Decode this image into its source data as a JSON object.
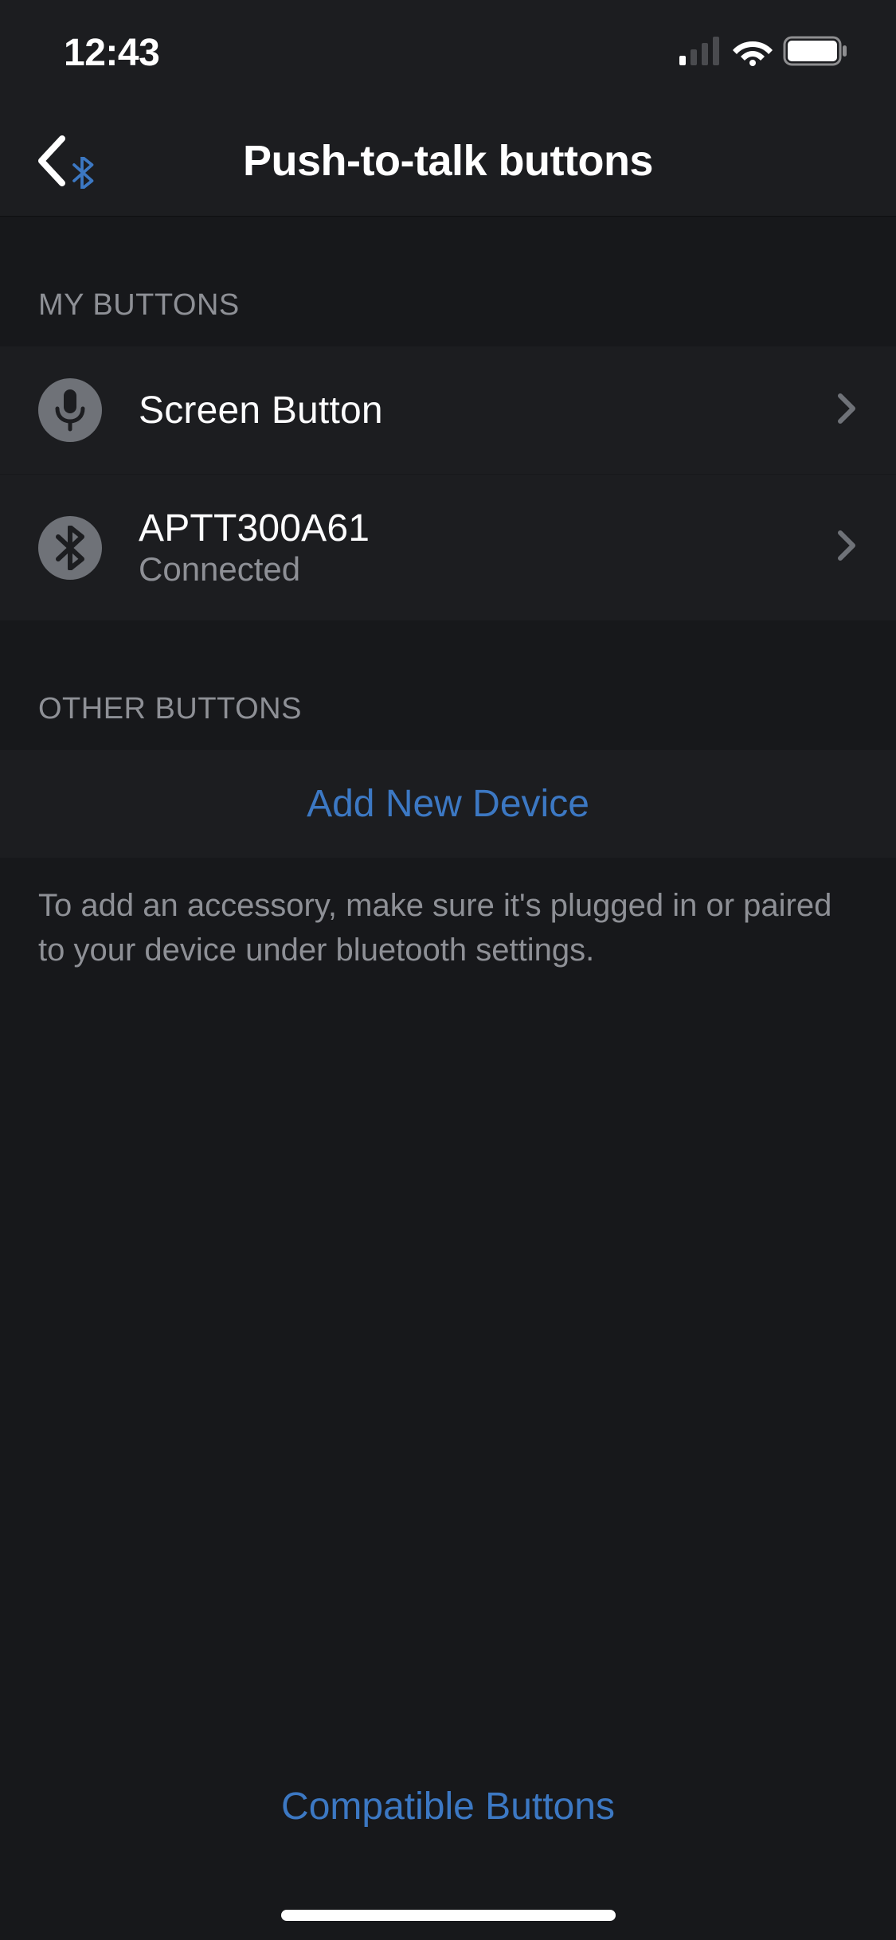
{
  "statusBar": {
    "time": "12:43"
  },
  "header": {
    "title": "Push-to-talk buttons"
  },
  "sections": {
    "myButtons": {
      "label": "MY BUTTONS",
      "items": [
        {
          "title": "Screen Button",
          "subtitle": "",
          "iconName": "mic-icon"
        },
        {
          "title": "APTT300A61",
          "subtitle": "Connected",
          "iconName": "bluetooth-icon"
        }
      ]
    },
    "otherButtons": {
      "label": "OTHER BUTTONS",
      "addDeviceLabel": "Add New Device",
      "helperText": "To add an accessory, make sure it's plugged in or paired to your device under bluetooth settings."
    }
  },
  "footer": {
    "compatibleButtons": "Compatible Buttons"
  }
}
